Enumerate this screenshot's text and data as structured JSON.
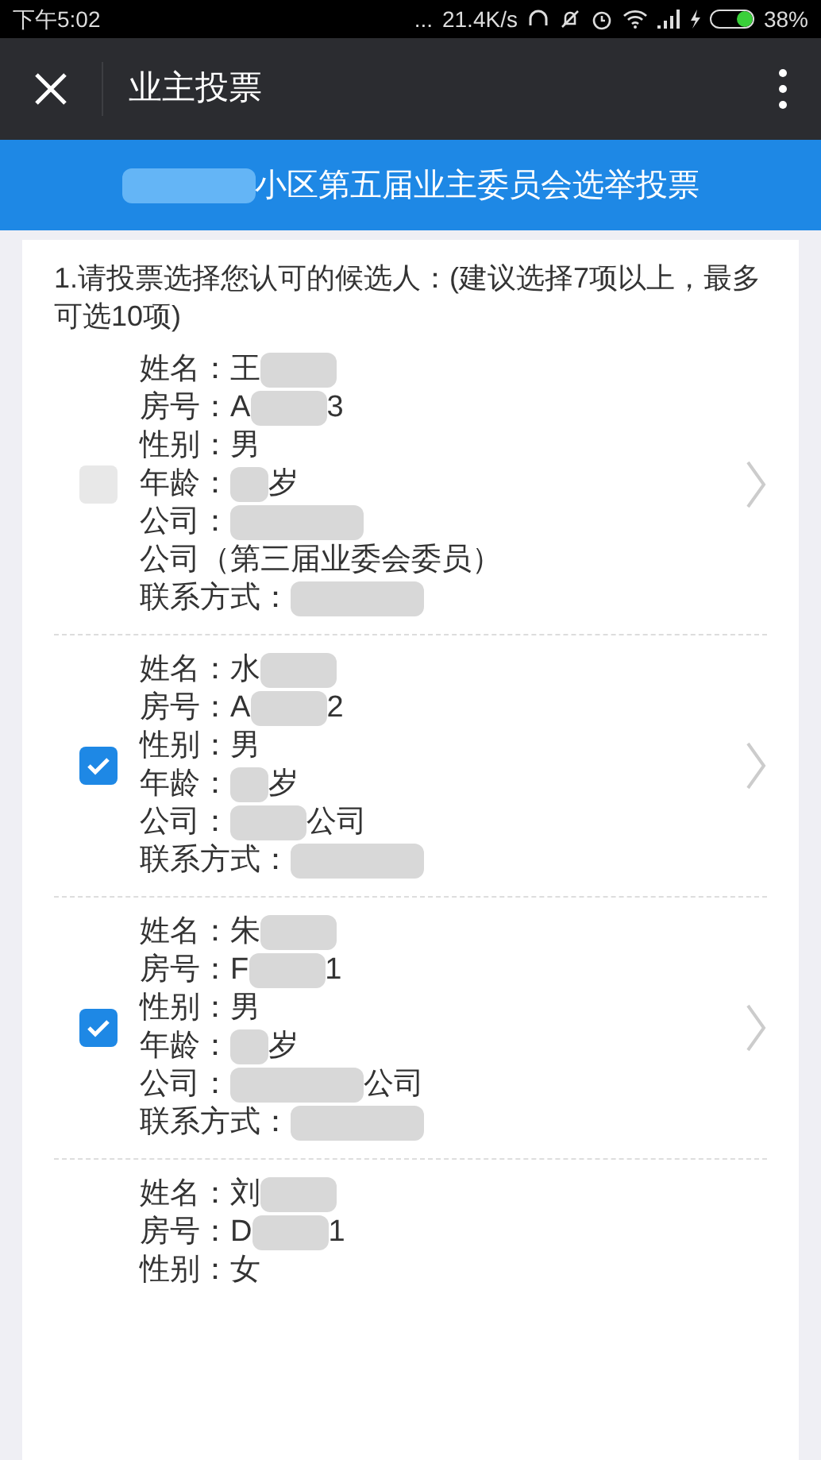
{
  "status_bar": {
    "time": "下午5:02",
    "more": "...",
    "speed": "21.4K/s",
    "battery": "38%"
  },
  "toolbar": {
    "title": "业主投票"
  },
  "banner": {
    "parts": [
      {
        "kind": "wide_blur"
      },
      {
        "kind": "text",
        "text": "小区第五届业主委员会选举投票"
      }
    ]
  },
  "question": {
    "text": "1.请投票选择您认可的候选人：(建议选择7项以上，最多可选10项)"
  },
  "candidates": [
    {
      "checked": false,
      "lines": [
        [
          {
            "kind": "text",
            "text": "姓名：王"
          },
          {
            "kind": "blur"
          }
        ],
        [
          {
            "kind": "text",
            "text": "房号：A"
          },
          {
            "kind": "blur"
          },
          {
            "kind": "text",
            "text": "3"
          }
        ],
        [
          {
            "kind": "text",
            "text": "性别：男"
          }
        ],
        [
          {
            "kind": "text",
            "text": "年龄："
          },
          {
            "kind": "small_blur"
          },
          {
            "kind": "text",
            "text": "岁"
          }
        ],
        [
          {
            "kind": "text",
            "text": "公司："
          },
          {
            "kind": "wide_blur"
          },
          {
            "kind": "text",
            "text": "公司（第三届业委会委员）"
          }
        ],
        [
          {
            "kind": "text",
            "text": "联系方式："
          },
          {
            "kind": "wide_blur"
          }
        ]
      ]
    },
    {
      "checked": true,
      "lines": [
        [
          {
            "kind": "text",
            "text": "姓名：水"
          },
          {
            "kind": "blur"
          }
        ],
        [
          {
            "kind": "text",
            "text": "房号：A"
          },
          {
            "kind": "blur"
          },
          {
            "kind": "text",
            "text": "2"
          }
        ],
        [
          {
            "kind": "text",
            "text": "性别：男"
          }
        ],
        [
          {
            "kind": "text",
            "text": "年龄："
          },
          {
            "kind": "small_blur"
          },
          {
            "kind": "text",
            "text": "岁"
          }
        ],
        [
          {
            "kind": "text",
            "text": "公司："
          },
          {
            "kind": "blur"
          },
          {
            "kind": "text",
            "text": "公司"
          }
        ],
        [
          {
            "kind": "text",
            "text": "联系方式："
          },
          {
            "kind": "wide_blur"
          }
        ]
      ]
    },
    {
      "checked": true,
      "lines": [
        [
          {
            "kind": "text",
            "text": "姓名：朱"
          },
          {
            "kind": "blur"
          }
        ],
        [
          {
            "kind": "text",
            "text": "房号：F"
          },
          {
            "kind": "blur"
          },
          {
            "kind": "text",
            "text": "1"
          }
        ],
        [
          {
            "kind": "text",
            "text": "性别：男"
          }
        ],
        [
          {
            "kind": "text",
            "text": "年龄："
          },
          {
            "kind": "small_blur"
          },
          {
            "kind": "text",
            "text": "岁"
          }
        ],
        [
          {
            "kind": "text",
            "text": "公司："
          },
          {
            "kind": "wide_blur"
          },
          {
            "kind": "text",
            "text": "公司"
          }
        ],
        [
          {
            "kind": "text",
            "text": "联系方式："
          },
          {
            "kind": "wide_blur"
          }
        ]
      ]
    },
    {
      "lines": [
        [
          {
            "kind": "text",
            "text": "姓名：刘"
          },
          {
            "kind": "blur"
          }
        ],
        [
          {
            "kind": "text",
            "text": "房号：D"
          },
          {
            "kind": "blur"
          },
          {
            "kind": "text",
            "text": "1"
          }
        ],
        [
          {
            "kind": "text",
            "text": "性别：女"
          }
        ]
      ]
    }
  ]
}
